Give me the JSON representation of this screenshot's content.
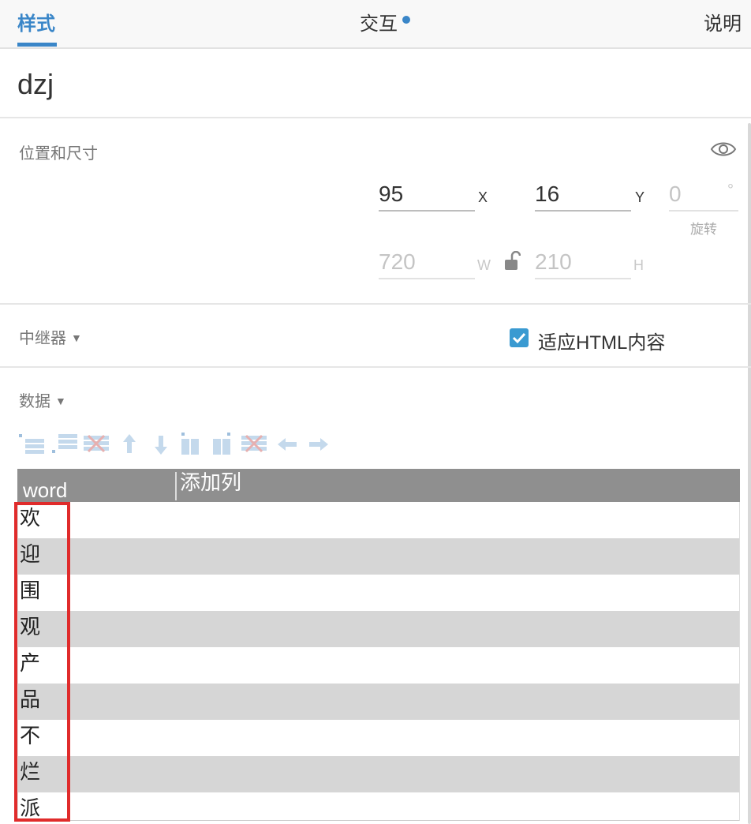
{
  "tabs": {
    "style_label": "样式",
    "interaction_label": "交互",
    "notes_label": "说明"
  },
  "widget": {
    "name": "dzj"
  },
  "position_section": {
    "title": "位置和尺寸",
    "x_value": "95",
    "x_label": "X",
    "y_value": "16",
    "y_label": "Y",
    "rotation_value": "0",
    "rotation_unit": "°",
    "rotation_label": "旋转",
    "width_value": "720",
    "width_label": "W",
    "height_value": "210",
    "height_label": "H"
  },
  "repeater_section": {
    "title": "中继器",
    "fit_html_label": "适应HTML内容",
    "fit_html_checked": true
  },
  "data_section": {
    "title": "数据",
    "toolbar_icons": [
      "insert-row-above-icon",
      "insert-row-below-icon",
      "delete-row-icon",
      "move-up-icon",
      "move-down-icon",
      "insert-column-left-icon",
      "insert-column-right-icon",
      "delete-column-icon",
      "move-left-icon",
      "move-right-icon"
    ],
    "columns": [
      "word",
      "添加列"
    ],
    "rows": [
      "欢",
      "迎",
      "围",
      "观",
      "产",
      "品",
      "不",
      "烂",
      "派"
    ]
  },
  "colors": {
    "accent": "#3a86c8",
    "checkbox": "#3a9ad1",
    "table_header": "#8f8f8f",
    "row_alt": "#d6d6d6",
    "highlight": "#e02b2b"
  }
}
